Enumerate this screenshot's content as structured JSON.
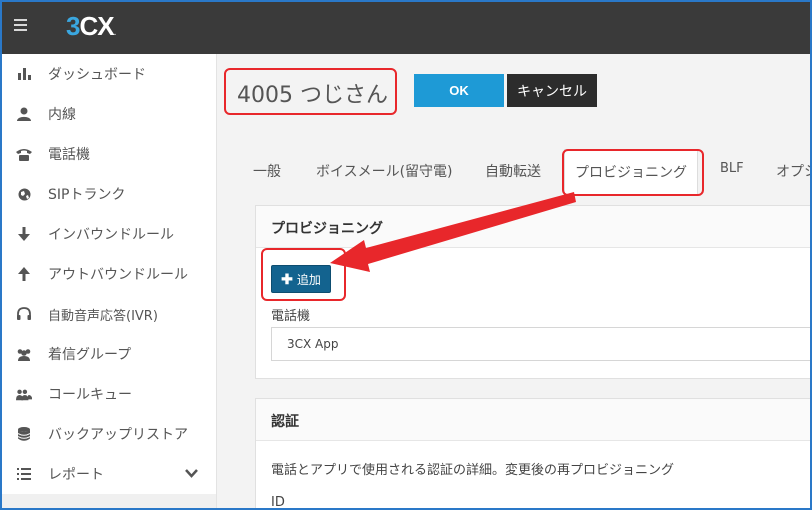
{
  "app": {
    "logo_num": "3",
    "logo_cx": "CX",
    "logo_dot": "."
  },
  "sidebar": {
    "items": [
      {
        "label": "ダッシュボード",
        "icon": "bar-chart-icon"
      },
      {
        "label": "内線",
        "icon": "user-icon"
      },
      {
        "label": "電話機",
        "icon": "phone-icon"
      },
      {
        "label": "SIPトランク",
        "icon": "globe-icon"
      },
      {
        "label": "インバウンドルール",
        "icon": "arrow-down-icon"
      },
      {
        "label": "アウトバウンドルール",
        "icon": "arrow-up-icon"
      },
      {
        "label": "自動音声応答(IVR)",
        "icon": "headset-icon"
      },
      {
        "label": "着信グループ",
        "icon": "users-icon"
      },
      {
        "label": "コールキュー",
        "icon": "group-icon"
      },
      {
        "label": "バックアップリストア",
        "icon": "database-icon"
      },
      {
        "label": "レポート",
        "icon": "list-icon",
        "expandable": true
      }
    ]
  },
  "header": {
    "extension_title": "4005 つじさん",
    "ok_label": "OK",
    "cancel_label": "キャンセル"
  },
  "tabs": [
    {
      "label": "一般"
    },
    {
      "label": "ボイスメール(留守電)"
    },
    {
      "label": "自動転送"
    },
    {
      "label": "プロビジョニング",
      "active": true
    },
    {
      "label": "BLF"
    },
    {
      "label": "オプシ"
    }
  ],
  "provisioning": {
    "title": "プロビジョニング",
    "add_label": "追加",
    "phone_label": "電話機",
    "phone_value": "3CX App"
  },
  "auth": {
    "title": "認証",
    "description": "電話とアプリで使用される認証の詳細。変更後の再プロビジョニング",
    "id_label": "ID"
  },
  "colors": {
    "topbar": "#3a3a3a",
    "accent": "#1e9ad6",
    "highlight": "#e8272b",
    "add_button": "#13638f"
  }
}
